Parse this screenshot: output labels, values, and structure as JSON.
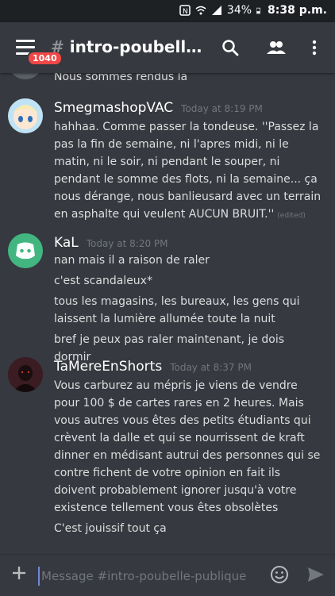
{
  "status_bar": {
    "battery": "34%",
    "time": "8:38 p.m."
  },
  "header": {
    "channel_name": "intro-poubelle-publique",
    "unread_count": "1040"
  },
  "messages": [
    {
      "partial_text": "Nous sommes rendus là"
    },
    {
      "username": "SmegmashopVAC",
      "timestamp": "Today at 8:19 PM",
      "lines": [
        "hahhaa. Comme passer la tondeuse. ''Passez la pas la fin de semaine, ni l'apres midi, ni le matin, ni le soir, ni pendant le souper, ni pendant le somme des flots, ni la semaine... ça nous dérange, nous banlieusard avec un terrain en asphalte qui veulent AUCUN BRUIT.''"
      ],
      "edited": "(edited)"
    },
    {
      "username": "KaL",
      "timestamp": "Today at 8:20 PM",
      "lines": [
        "nan mais il a raison de raler",
        "c'est scandaleux*",
        "tous les magasins, les bureaux, les gens qui laissent la lumière allumée toute la nuit",
        "bref je peux pas raler maintenant, je dois dormir"
      ]
    },
    {
      "username": "TaMereEnShorts",
      "timestamp": "Today at 8:37 PM",
      "lines": [
        "Vous carburez au mépris je viens de vendre pour 100 $ de cartes rares en 2 heures. Mais vous autres vous êtes des petits étudiants qui crèvent la dalle et qui se nourrissent de kraft dinner en médisant autrui des personnes qui se contre fichent de votre opinion en fait ils doivent probablement ignorer jusqu'à votre existence tellement vous êtes obsolètes",
        "C'est jouissif tout ça"
      ]
    }
  ],
  "composer": {
    "placeholder": "Message #intro-poubelle-publique"
  },
  "colors": {
    "background": "#36393f",
    "badge": "#f04747",
    "discord_blurple": "#7289da",
    "kal_avatar": "#43b581"
  }
}
